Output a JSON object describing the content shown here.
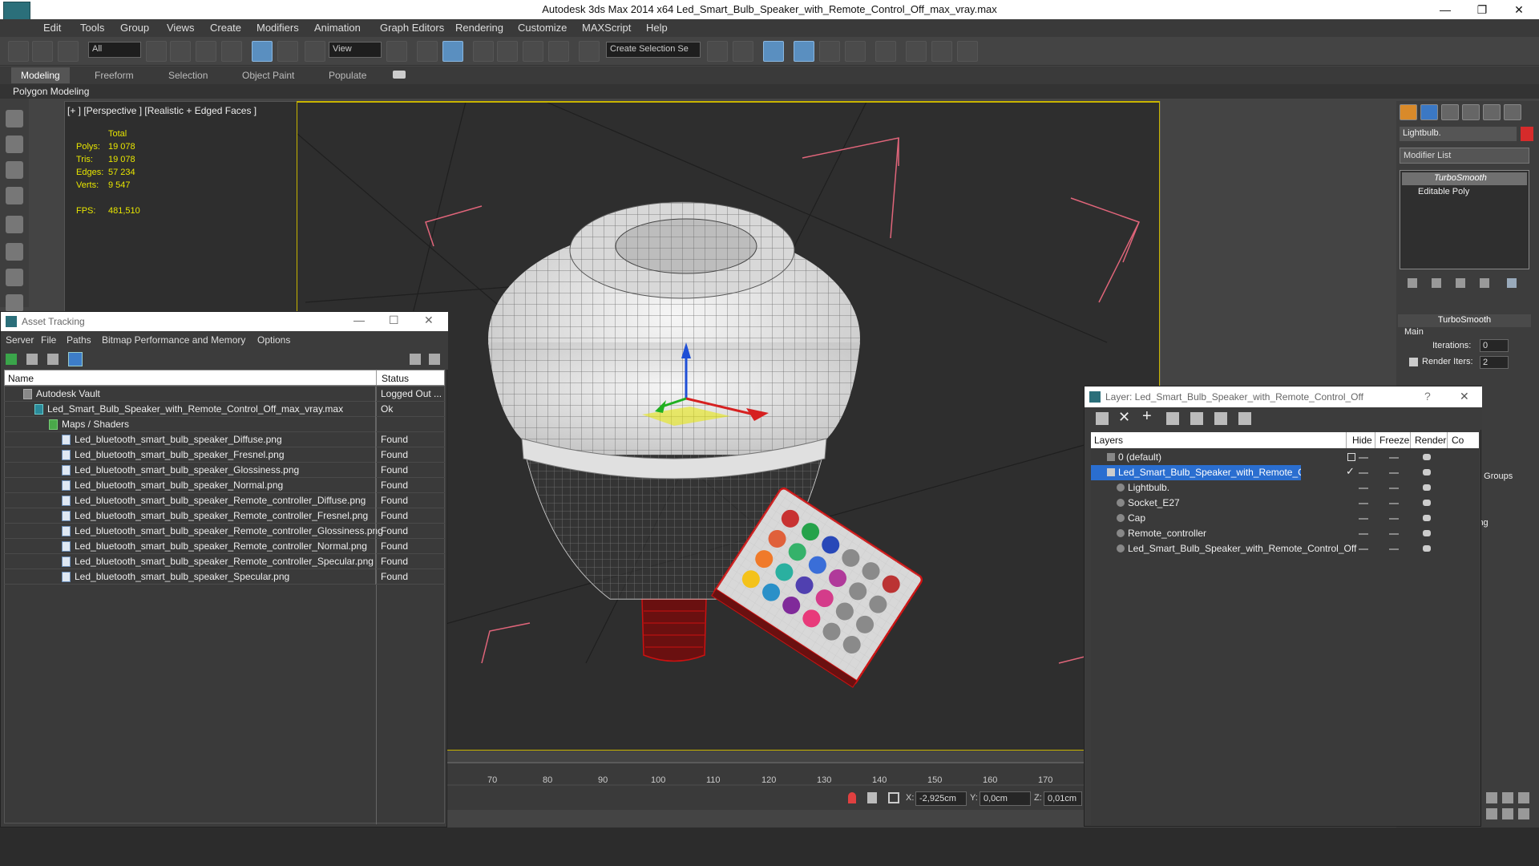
{
  "window": {
    "title": "Autodesk 3ds Max  2014 x64     Led_Smart_Bulb_Speaker_with_Remote_Control_Off_max_vray.max",
    "minimize": "—",
    "maximize": "❐",
    "close": "✕"
  },
  "menubar": [
    "Edit",
    "Tools",
    "Group",
    "Views",
    "Create",
    "Modifiers",
    "Animation",
    "Graph Editors",
    "Rendering",
    "Customize",
    "MAXScript",
    "Help"
  ],
  "toolbar": {
    "filter_value": "All",
    "refcoord_value": "View",
    "named_selection_placeholder": "Create Selection Se"
  },
  "ribbon": {
    "tabs": [
      "Modeling",
      "Freeform",
      "Selection",
      "Object Paint",
      "Populate"
    ],
    "active_tab": "Modeling",
    "sub_label": "Polygon Modeling"
  },
  "viewport": {
    "label": "[+ ] [Perspective ] [Realistic + Edged Faces ]",
    "stats": {
      "header": "Total",
      "polys_label": "Polys:",
      "polys": "19 078",
      "tris_label": "Tris:",
      "tris": "19 078",
      "edges_label": "Edges:",
      "edges": "57 234",
      "verts_label": "Verts:",
      "verts": "9 547",
      "fps_label": "FPS:",
      "fps": "481,510"
    }
  },
  "asset_tracking": {
    "title": "Asset Tracking",
    "menu": [
      "Server",
      "File",
      "Paths",
      "Bitmap Performance and Memory",
      "Options"
    ],
    "columns": {
      "name": "Name",
      "status": "Status"
    },
    "rows": [
      {
        "name": "Autodesk Vault",
        "status": "Logged Out ..."
      },
      {
        "name": "Led_Smart_Bulb_Speaker_with_Remote_Control_Off_max_vray.max",
        "status": "Ok"
      },
      {
        "name": "Maps / Shaders",
        "status": ""
      },
      {
        "name": "Led_bluetooth_smart_bulb_speaker_Diffuse.png",
        "status": "Found"
      },
      {
        "name": "Led_bluetooth_smart_bulb_speaker_Fresnel.png",
        "status": "Found"
      },
      {
        "name": "Led_bluetooth_smart_bulb_speaker_Glossiness.png",
        "status": "Found"
      },
      {
        "name": "Led_bluetooth_smart_bulb_speaker_Normal.png",
        "status": "Found"
      },
      {
        "name": "Led_bluetooth_smart_bulb_speaker_Remote_controller_Diffuse.png",
        "status": "Found"
      },
      {
        "name": "Led_bluetooth_smart_bulb_speaker_Remote_controller_Fresnel.png",
        "status": "Found"
      },
      {
        "name": "Led_bluetooth_smart_bulb_speaker_Remote_controller_Glossiness.png",
        "status": "Found"
      },
      {
        "name": "Led_bluetooth_smart_bulb_speaker_Remote_controller_Normal.png",
        "status": "Found"
      },
      {
        "name": "Led_bluetooth_smart_bulb_speaker_Remote_controller_Specular.png",
        "status": "Found"
      },
      {
        "name": "Led_bluetooth_smart_bulb_speaker_Specular.png",
        "status": "Found"
      }
    ]
  },
  "layer_dialog": {
    "title": "Layer: Led_Smart_Bulb_Speaker_with_Remote_Control_Off",
    "help": "?",
    "close": "✕",
    "columns": {
      "layers": "Layers",
      "hide": "Hide",
      "freeze": "Freeze",
      "render": "Render",
      "color": "Co"
    },
    "rows": [
      {
        "name": "0 (default)"
      },
      {
        "name": "Led_Smart_Bulb_Speaker_with_Remote_Control_Off"
      },
      {
        "name": "Lightbulb."
      },
      {
        "name": "Socket_E27"
      },
      {
        "name": "Cap"
      },
      {
        "name": "Remote_controller"
      },
      {
        "name": "Led_Smart_Bulb_Speaker_with_Remote_Control_Off"
      }
    ]
  },
  "command_panel": {
    "object_name": "Lightbulb.",
    "object_color": "#d62b2b",
    "modifier_list": "Modifier List",
    "stack": [
      "TurboSmooth",
      "Editable Poly"
    ],
    "rollout_title": "TurboSmooth",
    "group_main": "Main",
    "iterations_label": "Iterations:",
    "iterations_value": "0",
    "render_iters_label": "Render Iters:",
    "render_iters_value": "2",
    "partial_label_1": "g Groups",
    "partial_label_2": "ing"
  },
  "timeline": {
    "ticks": [
      "70",
      "80",
      "90",
      "100",
      "110",
      "120",
      "130",
      "140",
      "150",
      "160",
      "170"
    ]
  },
  "status": {
    "x_label": "X:",
    "x_value": "-2,925cm",
    "y_label": "Y:",
    "y_value": "0,0cm",
    "z_label": "Z:",
    "z_value": "0,01cm"
  },
  "colors": {
    "accent": "#1e6fd9",
    "selection_yellow": "#c8b400",
    "bounding_pink": "#e0657a",
    "wire_red": "#cc1111"
  }
}
